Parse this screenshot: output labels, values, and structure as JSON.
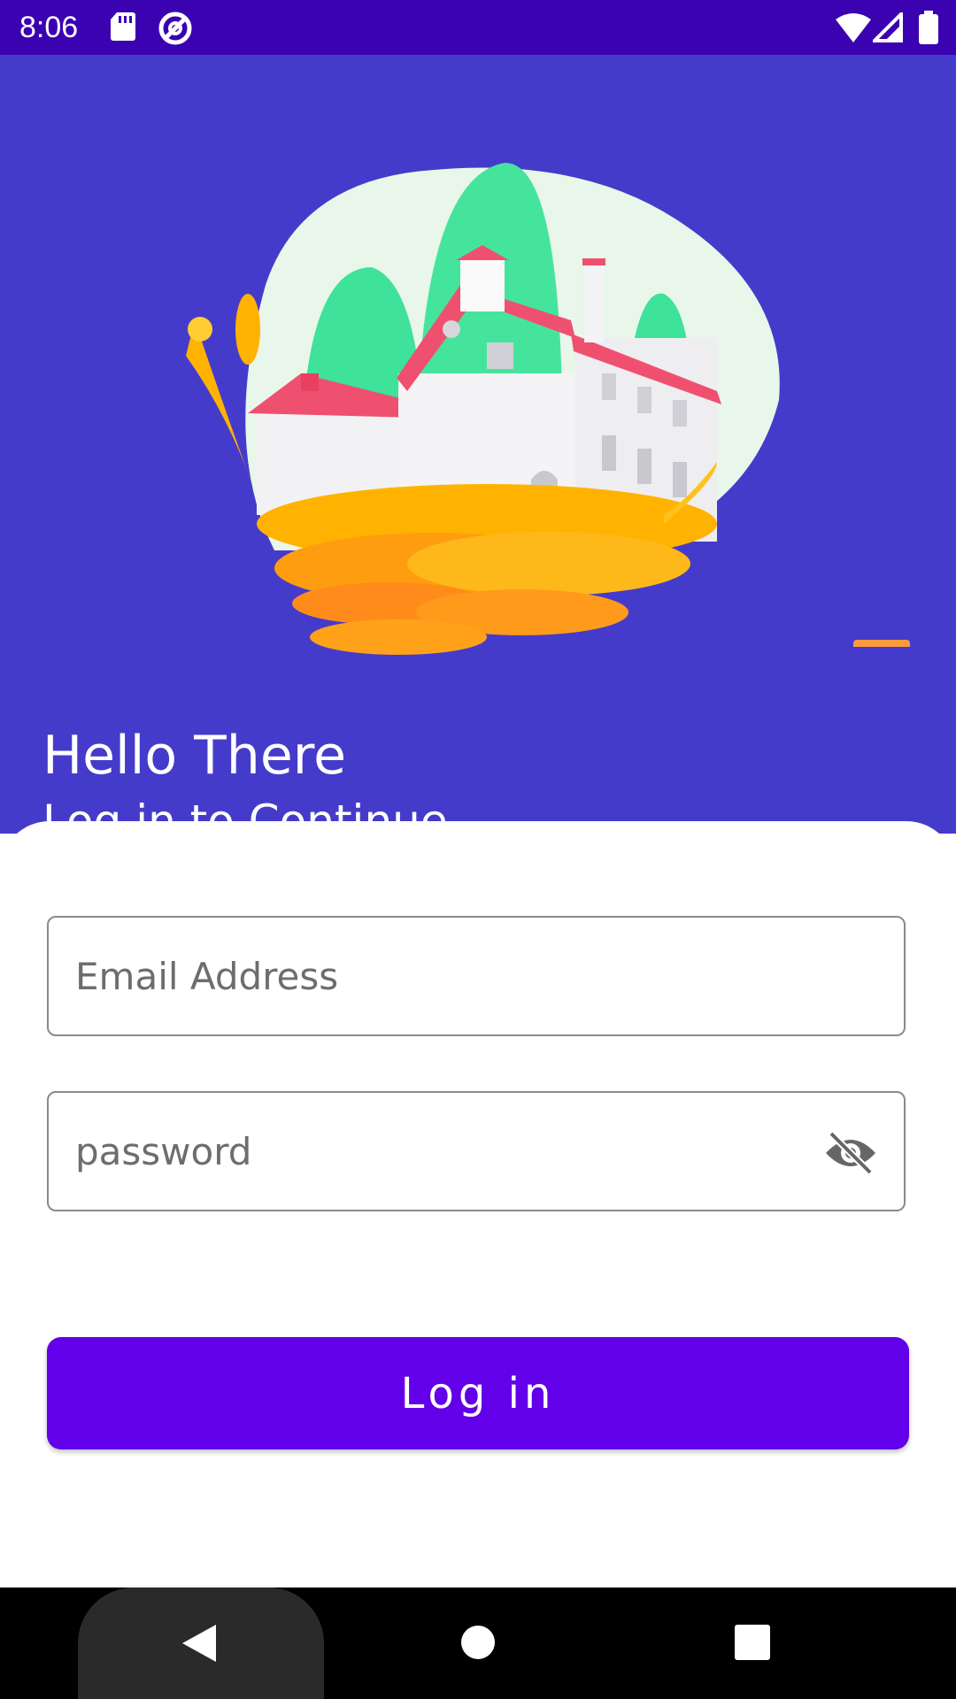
{
  "status_bar": {
    "time": "8:06",
    "icons": [
      "sd-card-icon",
      "sync-icon",
      "wifi-icon",
      "signal-icon",
      "battery-icon"
    ]
  },
  "hero": {
    "greeting": "Hello There",
    "subtitle": "Log in to Continue"
  },
  "form": {
    "email_placeholder": "Email Address",
    "email_value": "",
    "password_placeholder": "password",
    "password_value": "",
    "password_toggle_icon": "eye-off-icon",
    "login_label": "Log in"
  },
  "nav_bar": {
    "buttons": [
      "back-icon",
      "home-icon",
      "recents-icon"
    ]
  },
  "colors": {
    "status_bar": "#3a02b0",
    "hero_bg": "#453bcb",
    "button": "#6200e9",
    "indicator": "#ff9a3c"
  }
}
